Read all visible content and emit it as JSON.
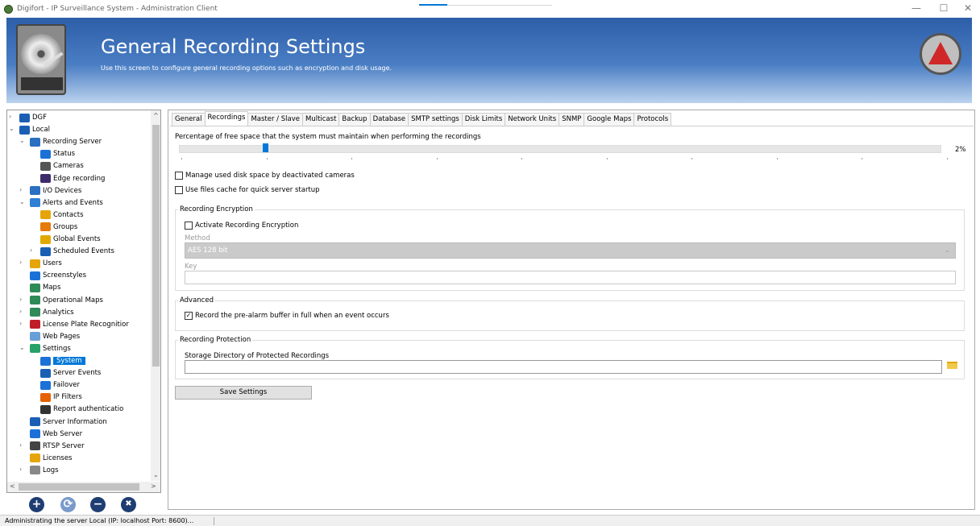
{
  "window": {
    "title": "Digifort - IP Surveillance System - Administration Client",
    "minimize": "—",
    "maximize": "☐",
    "close": "✕"
  },
  "header": {
    "title": "General Recording Settings",
    "subtitle": "Use this screen to configure general recording options such as encryption and disk usage."
  },
  "tree": {
    "items": [
      {
        "label": "DGF",
        "exp": "›",
        "icon": "server-icon"
      },
      {
        "label": "Local",
        "exp": "⌄",
        "icon": "server-icon"
      },
      {
        "label": "Recording Server",
        "exp": "⌄",
        "icon": "recording-server-icon"
      },
      {
        "label": "Status",
        "exp": "",
        "icon": "monitor-icon"
      },
      {
        "label": "Cameras",
        "exp": "",
        "icon": "camera-icon"
      },
      {
        "label": "Edge recording",
        "exp": "",
        "icon": "edge-recording-icon"
      },
      {
        "label": "I/O Devices",
        "exp": "›",
        "icon": "io-device-icon"
      },
      {
        "label": "Alerts and Events",
        "exp": "⌄",
        "icon": "alert-icon"
      },
      {
        "label": "Contacts",
        "exp": "",
        "icon": "contact-icon"
      },
      {
        "label": "Groups",
        "exp": "",
        "icon": "group-icon"
      },
      {
        "label": "Global Events",
        "exp": "",
        "icon": "global-events-icon"
      },
      {
        "label": "Scheduled Events",
        "exp": "›",
        "icon": "scheduled-events-icon"
      },
      {
        "label": "Users",
        "exp": "›",
        "icon": "users-icon"
      },
      {
        "label": "Screenstyles",
        "exp": "",
        "icon": "screenstyles-icon"
      },
      {
        "label": "Maps",
        "exp": "",
        "icon": "globe-icon"
      },
      {
        "label": "Operational Maps",
        "exp": "›",
        "icon": "globe-icon"
      },
      {
        "label": "Analytics",
        "exp": "›",
        "icon": "globe-icon"
      },
      {
        "label": "License Plate Recognitior",
        "exp": "›",
        "icon": "car-icon"
      },
      {
        "label": "Web Pages",
        "exp": "",
        "icon": "web-page-icon"
      },
      {
        "label": "Settings",
        "exp": "⌄",
        "icon": "gear-icon"
      },
      {
        "label": "System",
        "exp": "",
        "icon": "system-icon"
      },
      {
        "label": "Server Events",
        "exp": "",
        "icon": "server-events-icon"
      },
      {
        "label": "Failover",
        "exp": "",
        "icon": "failover-icon"
      },
      {
        "label": "IP Filters",
        "exp": "",
        "icon": "ip-filter-icon"
      },
      {
        "label": "Report authenticatio",
        "exp": "",
        "icon": "report-icon"
      },
      {
        "label": "Server Information",
        "exp": "",
        "icon": "server-info-icon"
      },
      {
        "label": "Web Server",
        "exp": "",
        "icon": "web-server-icon"
      },
      {
        "label": "RTSP Server",
        "exp": "›",
        "icon": "rtsp-icon"
      },
      {
        "label": "Licenses",
        "exp": "",
        "icon": "key-icon"
      },
      {
        "label": "Logs",
        "exp": "›",
        "icon": "log-icon"
      }
    ],
    "selected": "System"
  },
  "actions": {
    "add": "+",
    "refresh": "⟳",
    "remove": "−",
    "delete": "✖"
  },
  "tabs": [
    "General",
    "Recordings",
    "Master / Slave",
    "Multicast",
    "Backup",
    "Database",
    "SMTP settings",
    "Disk Limits",
    "Network Units",
    "SNMP",
    "Google Maps",
    "Protocols"
  ],
  "active_tab": "Recordings",
  "recordings": {
    "free_space_label": "Percentage of free space that the system must maintain when performing the recordings",
    "free_space_value": "2%",
    "free_space_percent": 2,
    "manage_disk_label": "Manage used disk space by deactivated cameras",
    "manage_disk_checked": false,
    "files_cache_label": "Use files cache for quick server startup",
    "files_cache_checked": false,
    "encryption": {
      "title": "Recording Encryption",
      "activate_label": "Activate Recording Encryption",
      "activate_checked": false,
      "method_label": "Method",
      "method_value": "AES 128 bit",
      "key_label": "Key",
      "key_value": ""
    },
    "advanced": {
      "title": "Advanced",
      "prealarm_label": "Record the pre-alarm buffer in full when an event occurs",
      "prealarm_checked": true
    },
    "protection": {
      "title": "Recording Protection",
      "dir_label": "Storage Directory of Protected Recordings",
      "dir_value": ""
    },
    "save_label": "Save Settings"
  },
  "status": {
    "text": "Administrating the server Local (IP: localhost Port: 8600)..."
  }
}
